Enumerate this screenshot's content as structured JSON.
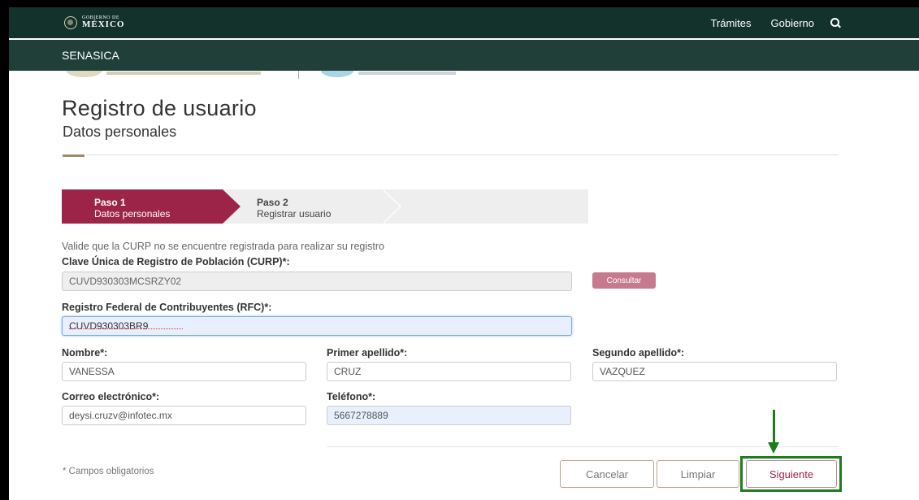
{
  "header": {
    "logo_small": "GOBIERNO DE",
    "logo_big": "MÉXICO",
    "nav": [
      "Trámites",
      "Gobierno"
    ],
    "search_icon": "search-icon"
  },
  "subheader": {
    "title": "SENASICA"
  },
  "page": {
    "title": "Registro de usuario",
    "subtitle": "Datos personales"
  },
  "stepper": {
    "steps": [
      {
        "label": "Paso 1",
        "sub": "Datos personales",
        "active": true
      },
      {
        "label": "Paso 2",
        "sub": "Registrar usuario",
        "active": false
      }
    ]
  },
  "form": {
    "info": "Valide que la CURP no se encuentre registrada para realizar su registro",
    "curp": {
      "label": "Clave Única de Registro de Población (CURP)*:",
      "value": "CUVD930303MCSRZY02"
    },
    "consult_button": "Consultar",
    "rfc": {
      "label": "Registro Federal de Contribuyentes (RFC)*:",
      "value": "CUVD930303BR9"
    },
    "nombre": {
      "label": "Nombre*:",
      "value": "VANESSA"
    },
    "primer_apellido": {
      "label": "Primer apellido*:",
      "value": "CRUZ"
    },
    "segundo_apellido": {
      "label": "Segundo apellido*:",
      "value": "VAZQUEZ"
    },
    "correo": {
      "label": "Correo electrónico*:",
      "value": "deysi.cruzv@infotec.mx"
    },
    "telefono": {
      "label": "Teléfono*:",
      "value": "5667278889"
    }
  },
  "footer": {
    "required_note": "* Campos obligatorios",
    "cancel": "Cancelar",
    "clear": "Limpiar",
    "next": "Siguiente"
  },
  "colors": {
    "header_bg": "#13322b",
    "subheader_bg": "#1f3f38",
    "brand_primary": "#9d2449",
    "highlight_green": "#1d7d1d"
  }
}
